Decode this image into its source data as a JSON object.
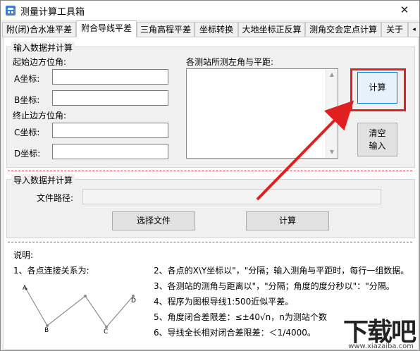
{
  "window": {
    "title": "测量计算工具箱",
    "close_glyph": "✕"
  },
  "tabs": [
    {
      "label": "附(闭)合水准平差",
      "active": false
    },
    {
      "label": "附合导线平差",
      "active": true
    },
    {
      "label": "三角高程平差",
      "active": false
    },
    {
      "label": "坐标转换",
      "active": false
    },
    {
      "label": "大地坐标正反算",
      "active": false
    },
    {
      "label": "测角交会定点计算",
      "active": false
    },
    {
      "label": "关于",
      "active": false
    }
  ],
  "input_group": {
    "legend": "输入数据并计算",
    "start_azimuth_label": "起始边方位角:",
    "a_label": "A坐标:",
    "b_label": "B坐标:",
    "end_azimuth_label": "终止边方位角:",
    "c_label": "C坐标:",
    "d_label": "D坐标:",
    "a_value": "",
    "b_value": "",
    "c_value": "",
    "d_value": "",
    "angles_label": "各测站所测左角与平距:",
    "angles_value": "",
    "calc_button": "计算",
    "clear_button": "清空\n输入"
  },
  "import_group": {
    "legend": "导入数据并计算",
    "path_label": "文件路径:",
    "path_value": "",
    "choose_button": "选择文件",
    "calc_button": "计算"
  },
  "notes": {
    "title": "说明:",
    "item1": "1、各点连接关系为:",
    "item2": "2、各点的X\\Y坐标以\"，\"分隔；输入测角与平距时，每行一组数据。",
    "item3": "3、各测站的测角与距离以\"，\"分隔；角度的度分秒以\"：\"分隔。",
    "item4": "4、程序为图根导线1:500近似平差。",
    "item5": "5、角度闭合差限差：≤±40√n，n为测站个数",
    "item6": "6、导线全长相对闭合差限差：＜1/4000。",
    "points": [
      "A",
      "B",
      "C",
      "D"
    ]
  },
  "watermark": {
    "text": "下载吧",
    "url": "www.xiazaiba.com"
  },
  "colors": {
    "highlight": "#e02020",
    "accent_button_border": "#0078d7"
  }
}
